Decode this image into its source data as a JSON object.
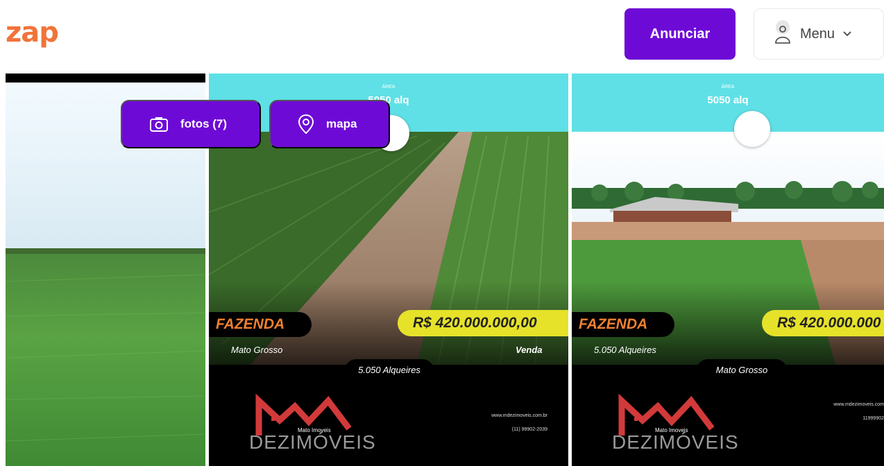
{
  "header": {
    "logo": "zap",
    "anunciar_label": "Anunciar",
    "menu_label": "Menu"
  },
  "overlay": {
    "fotos_label": "fotos (7)",
    "mapa_label": "mapa"
  },
  "listing_2": {
    "area_label": "ÁREA",
    "area_value": "5050 alq",
    "type": "FAZENDA",
    "price": "R$ 420.000.000,00",
    "location": "Mato Grosso",
    "deal": "Venda",
    "size": "5.050 Alqueires",
    "brand_name": "DEZIMÓVEIS",
    "brand_small": "Mato Imoveis",
    "website": "www.mdezimoveis.com.br",
    "phone": "(11) 99902-2039"
  },
  "listing_3": {
    "area_label": "ÁREA",
    "area_value": "5050 alq",
    "type": "FAZENDA",
    "price": "R$ 420.000.000",
    "size": "5.050 Alqueires",
    "location": "Mato Grosso",
    "brand_name": "DEZIMÓVEIS",
    "brand_small": "Mato Imoveis",
    "website": "www.mdezimoveis.com",
    "phone": "11999902"
  },
  "colors": {
    "brand_purple": "#6e0ad6",
    "logo_orange": "#f0743a",
    "teal": "#5fe0e6",
    "price_yellow": "#e6e22a"
  },
  "icons": [
    "user-icon",
    "chevron-down-icon",
    "camera-icon",
    "map-pin-icon",
    "building-icon"
  ]
}
